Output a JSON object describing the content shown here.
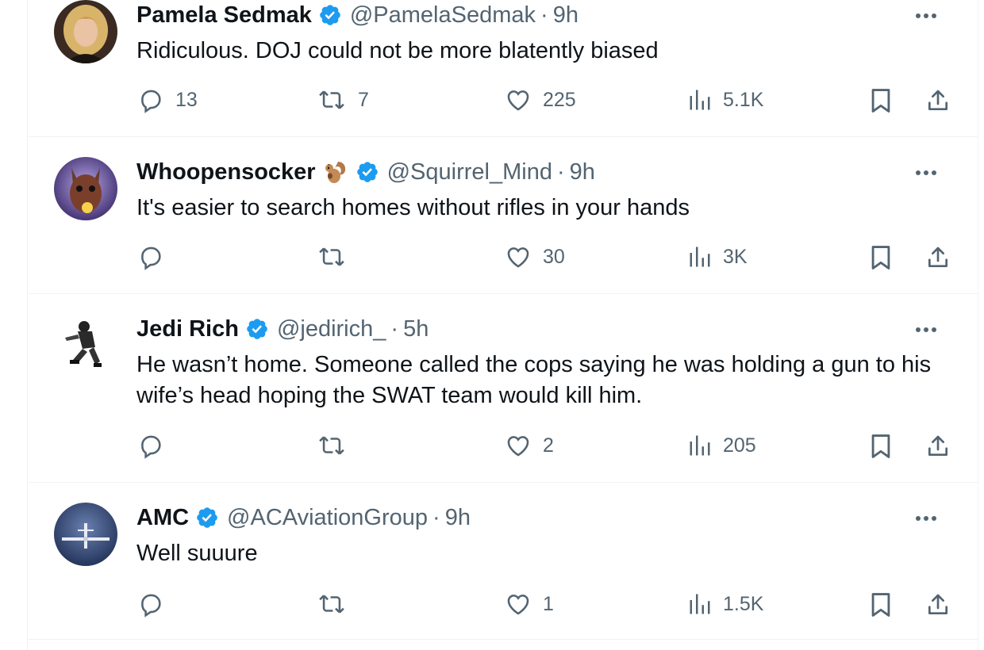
{
  "tweets": [
    {
      "name": "Pamela Sedmak",
      "handle": "@PamelaSedmak",
      "separator": "·",
      "time": "9h",
      "text": "Ridiculous. DOJ could not be more blatently biased",
      "replies": "13",
      "retweets": "7",
      "likes": "225",
      "views": "5.1K",
      "avatar": "woman-blonde-portrait"
    },
    {
      "name": "Whoopensocker",
      "emoji": "squirrel-emoji",
      "handle": "@Squirrel_Mind",
      "separator": "·",
      "time": "9h",
      "text": "It's easier to search homes without rifles in your hands",
      "replies": "",
      "retweets": "",
      "likes": "30",
      "views": "3K",
      "avatar": "squirrel-illustration"
    },
    {
      "name": "Jedi Rich",
      "handle": "@jedirich_",
      "separator": "·",
      "time": "5h",
      "text": "He wasn’t home. Someone called the cops saying he was holding a gun to his wife’s head hoping the SWAT team would kill him.",
      "replies": "",
      "retweets": "",
      "likes": "2",
      "views": "205",
      "avatar": "crouching-figure"
    },
    {
      "name": "AMC",
      "handle": "@ACAviationGroup",
      "separator": "·",
      "time": "9h",
      "text": "Well suuure",
      "replies": "",
      "retweets": "",
      "likes": "1",
      "views": "1.5K",
      "avatar": "airplane-logo"
    }
  ],
  "colors": {
    "verified": "#1d9bf0",
    "muted": "#536471",
    "text": "#0f1419",
    "divider": "#eff3f4"
  }
}
